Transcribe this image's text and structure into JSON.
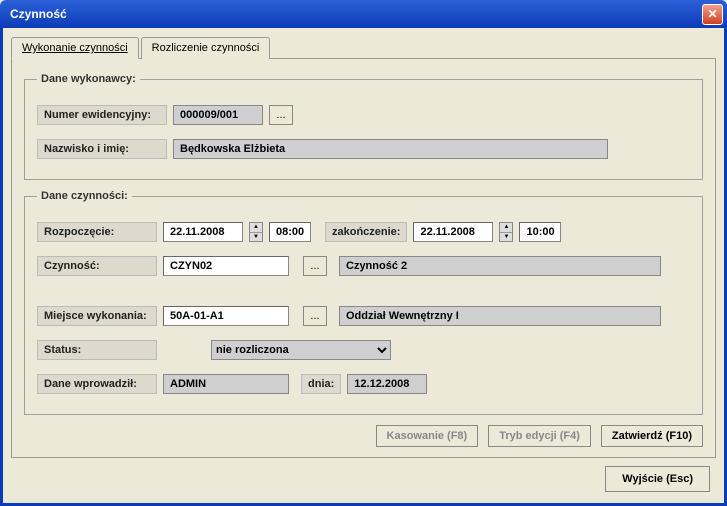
{
  "window": {
    "title": "Czynność"
  },
  "tabs": {
    "tab1": "Wykonanie czynności",
    "tab2": "Rozliczenie czynności"
  },
  "group1": {
    "legend": "Dane wykonawcy:",
    "id_label": "Numer ewidencyjny:",
    "id_value": "000009/001",
    "browse": "...",
    "name_label": "Nazwisko i imię:",
    "name_value": "Będkowska Elżbieta"
  },
  "group2": {
    "legend": "Dane czynności:",
    "start_label": "Rozpoczęcie:",
    "start_date": "22.11.2008",
    "start_time": "08:00",
    "end_label": "zakończenie:",
    "end_date": "22.11.2008",
    "end_time": "10:00",
    "activity_label": "Czynność:",
    "activity_code": "CZYN02",
    "activity_browse": "...",
    "activity_desc": "Czynność 2",
    "place_label": "Miejsce wykonania:",
    "place_code": "50A-01-A1",
    "place_browse": "...",
    "place_desc": "Oddział Wewnętrzny I",
    "status_label": "Status:",
    "status_value": "nie rozliczona",
    "entered_label": "Dane wprowadził:",
    "entered_by": "ADMIN",
    "entered_on_label": "dnia:",
    "entered_on": "12.12.2008"
  },
  "buttons": {
    "delete": "Kasowanie (F8)",
    "edit": "Tryb edycji (F4)",
    "confirm": "Zatwierdź (F10)",
    "exit": "Wyjście (Esc)"
  }
}
